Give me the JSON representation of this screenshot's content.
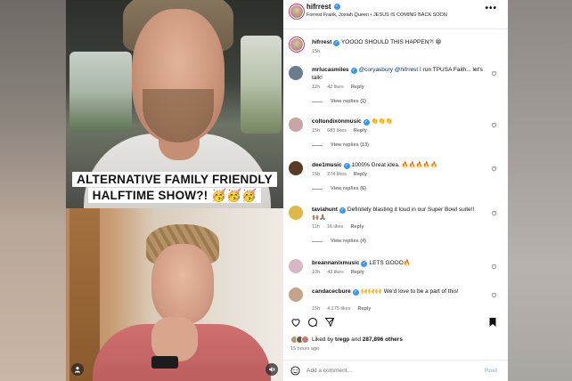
{
  "video": {
    "caption_line1": "ALTERNATIVE FAMILY FRIENDLY",
    "caption_line2": "HALFTIME SHOW?! 🥳🥳🥳"
  },
  "post": {
    "username": "hifrrest",
    "subtitle": "Forrest Frank, Josiah Queen • JESUS IS COMING BACK SOON",
    "more_icon": "•••"
  },
  "caption_comment": {
    "username": "hifrrest",
    "text": "YOOOO SHOULD THIS HAPPEN?! 😁",
    "time": "15h"
  },
  "comments": [
    {
      "username": "mrlucasmiles",
      "mention": "@coryasbury @hifrrest",
      "text": "I run TPUSA Faith... let's talk!",
      "time": "12h",
      "likes": "42 likes",
      "reply": "Reply",
      "view_replies": "View replies (1)",
      "avatar_color": "#6b7c8c"
    },
    {
      "username": "coltondixonmusic",
      "mention": "",
      "text": "👏👏👏",
      "time": "15h",
      "likes": "683 likes",
      "reply": "Reply",
      "view_replies": "View replies (13)",
      "avatar_color": "#c9a4a4"
    },
    {
      "username": "dee1music",
      "mention": "",
      "text": "1000% Great idea. 🔥🔥🔥🔥🔥",
      "time": "15h",
      "likes": "274 likes",
      "reply": "Reply",
      "view_replies": "View replies (6)",
      "avatar_color": "#5a3a22"
    },
    {
      "username": "taviahunt",
      "mention": "",
      "text": "Definitely blasting it loud in our Super Bowl suite!! 🙌🏽🙏🏽",
      "time": "11h",
      "likes": "16 likes",
      "reply": "Reply",
      "view_replies": "View replies (4)",
      "avatar_color": "#e0b84a"
    },
    {
      "username": "breannanixmusic",
      "mention": "",
      "text": "LETS GOOO🔥",
      "time": "10h",
      "likes": "43 likes",
      "reply": "Reply",
      "view_replies": "",
      "avatar_color": "#d9b5c5"
    },
    {
      "username": "candacecbure",
      "mention": "",
      "text": "🙌🙌🙌 We'd love to be a part of this!",
      "time": "15h",
      "likes": "4,175 likes",
      "reply": "Reply",
      "view_replies": "",
      "avatar_color": "#c4a38a"
    }
  ],
  "likes_summary": {
    "prefix": "Liked by",
    "first": "tregp",
    "middle": "and",
    "count": "287,896 others"
  },
  "time_ago": "15 hours ago",
  "add_comment": {
    "placeholder": "Add a comment…",
    "post_label": "Post"
  },
  "colors": {
    "verified": "#3897f0",
    "link": "#00376b",
    "muted": "#737373",
    "post_button": "#8bc3f5",
    "story_ring": "#d62976"
  },
  "icons": [
    "more-icon",
    "heart-icon",
    "comment-icon",
    "share-icon",
    "bookmark-icon",
    "verified-icon",
    "user-icon",
    "mute-icon",
    "emoji-icon"
  ]
}
